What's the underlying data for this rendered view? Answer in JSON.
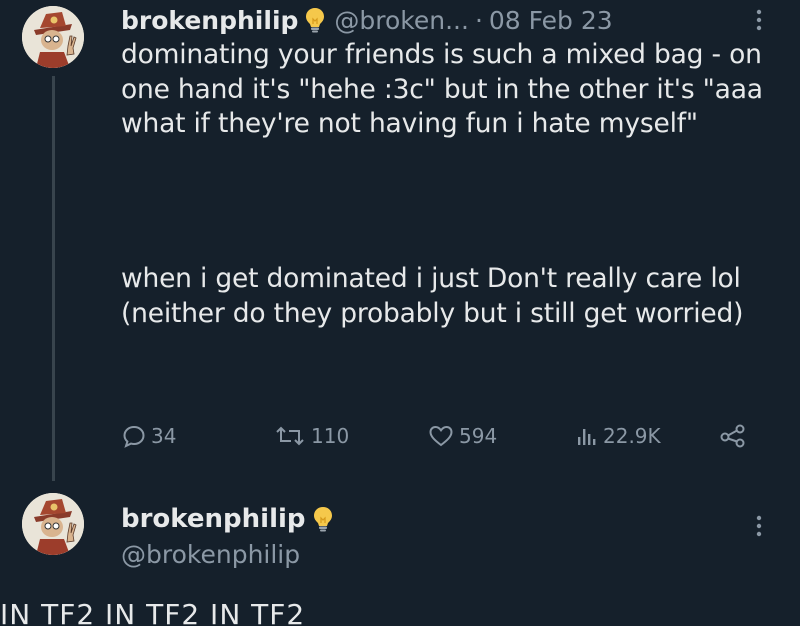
{
  "tweet": {
    "author": {
      "display_name": "brokenphilip",
      "handle": "@broken...",
      "badge_icon": "lightbulb-icon"
    },
    "separator": "·",
    "date": "08 Feb 23",
    "paragraphs": [
      "dominating your friends is such a mixed bag - on one hand it's \"hehe :3c\" but in the other it's \"aaa what if they're not having fun i hate myself\"",
      "when i get dominated i just Don't really care lol (neither do they probably but i still get worried)"
    ],
    "actions": {
      "replies": "34",
      "retweets": "110",
      "likes": "594",
      "views": "22.9K"
    }
  },
  "reply": {
    "author": {
      "display_name": "brokenphilip",
      "handle": "@brokenphilip",
      "badge_icon": "lightbulb-icon"
    },
    "text_preview": "IN TF2 IN TF2 IN TF2"
  },
  "colors": {
    "background": "#15202b",
    "text": "#e7e9ea",
    "secondary": "#8b98a5",
    "bulb": "#f5c84b"
  }
}
